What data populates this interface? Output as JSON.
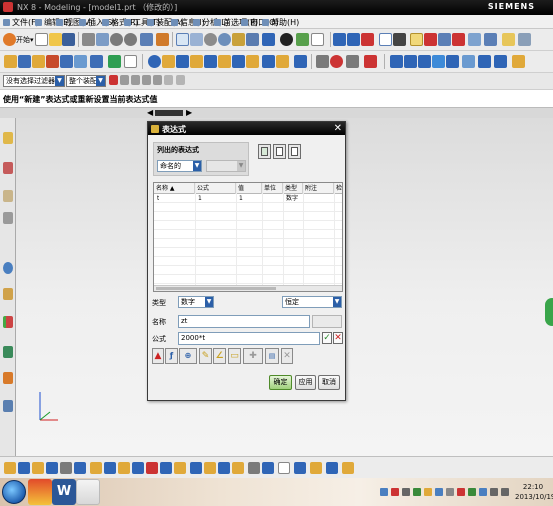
{
  "window": {
    "title": "NX 8 - Modeling - [model1.prt （修改的）]",
    "brand": "SIEMENS"
  },
  "menubar": {
    "items": [
      "文件(F)",
      "编辑(E)",
      "视图(V)",
      "插入(S)",
      "格式(R)",
      "工具(T)",
      "装配(A)",
      "信息(I)",
      "分析(L)",
      "首选项(P)",
      "窗口(O)",
      "帮助(H)"
    ]
  },
  "toolbar1": {
    "start_label": "开始▾"
  },
  "selection_bar": {
    "filter_value": "没有选择过滤器",
    "scope_value": "整个装配"
  },
  "cue_line": "使用“新建”表达式或重新设置当前表达式值",
  "dialog": {
    "title": "表达式",
    "listed_label": "列出的表达式",
    "listed_value": "命名的",
    "table": {
      "columns": [
        "名称 ▲",
        "公式",
        "值",
        "单位",
        "类型",
        "附注",
        "检查"
      ],
      "rows": [
        [
          "t",
          "1",
          "1",
          "",
          "数字",
          "",
          ""
        ]
      ]
    },
    "type_label": "类型",
    "type_value": "数字",
    "unit_value": "恒定",
    "name_label": "名称",
    "name_value": "zt",
    "formula_label": "公式",
    "formula_value": "2000*t",
    "buttons": {
      "ok": "确定",
      "apply": "应用",
      "cancel": "取消"
    }
  },
  "taskbar": {
    "time": "22:10",
    "date": "2013/10/19"
  },
  "colors": {
    "title_bar": "#000000",
    "dialog_title": "#111111",
    "accent_blue": "#2b5fa8",
    "ok_green": "#9fd07b"
  }
}
